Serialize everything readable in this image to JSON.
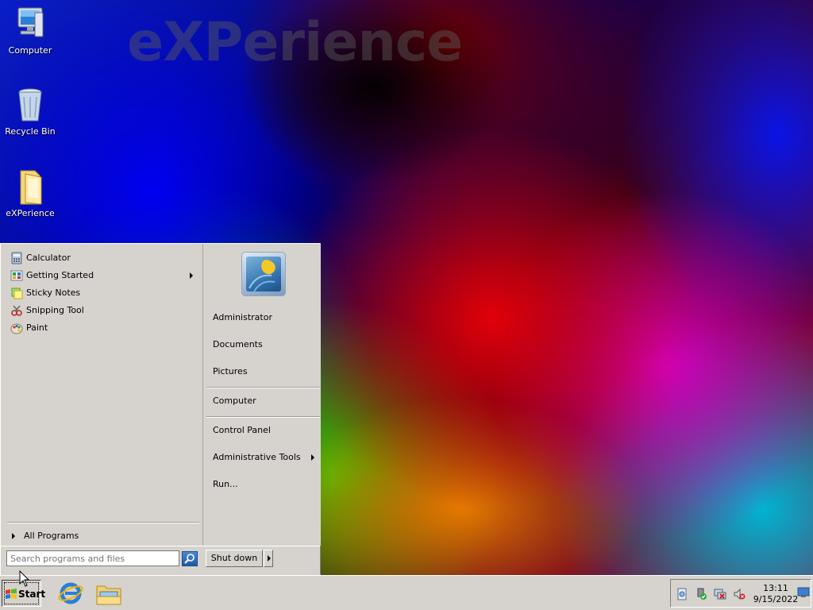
{
  "desktop": {
    "wallpaper_text": "eXPerience",
    "icons": [
      {
        "label": "Computer",
        "icon": "computer-icon"
      },
      {
        "label": "Recycle Bin",
        "icon": "recycle-bin-icon"
      },
      {
        "label": "eXPerience",
        "icon": "folder-icon"
      }
    ]
  },
  "start_menu": {
    "programs": [
      {
        "label": "Calculator",
        "icon": "calculator-icon"
      },
      {
        "label": "Getting Started",
        "icon": "getting-started-icon",
        "submenu": true
      },
      {
        "label": "Sticky Notes",
        "icon": "sticky-notes-icon"
      },
      {
        "label": "Snipping Tool",
        "icon": "snipping-tool-icon"
      },
      {
        "label": "Paint",
        "icon": "paint-icon"
      }
    ],
    "all_programs": "All Programs",
    "right": {
      "user": "Administrator",
      "documents": "Documents",
      "pictures": "Pictures",
      "computer": "Computer",
      "control_panel": "Control Panel",
      "admin_tools": "Administrative Tools",
      "run": "Run..."
    },
    "search_placeholder": "Search programs and files",
    "shutdown": "Shut down"
  },
  "taskbar": {
    "start_label": "Start",
    "quick_launch": [
      "internet-explorer-icon",
      "windows-explorer-icon"
    ],
    "tray_icons": [
      "action-center-icon",
      "safely-remove-hardware-icon",
      "network-disconnected-icon",
      "volume-muted-icon"
    ],
    "clock_time": "13:11",
    "clock_date": "9/15/2022"
  }
}
